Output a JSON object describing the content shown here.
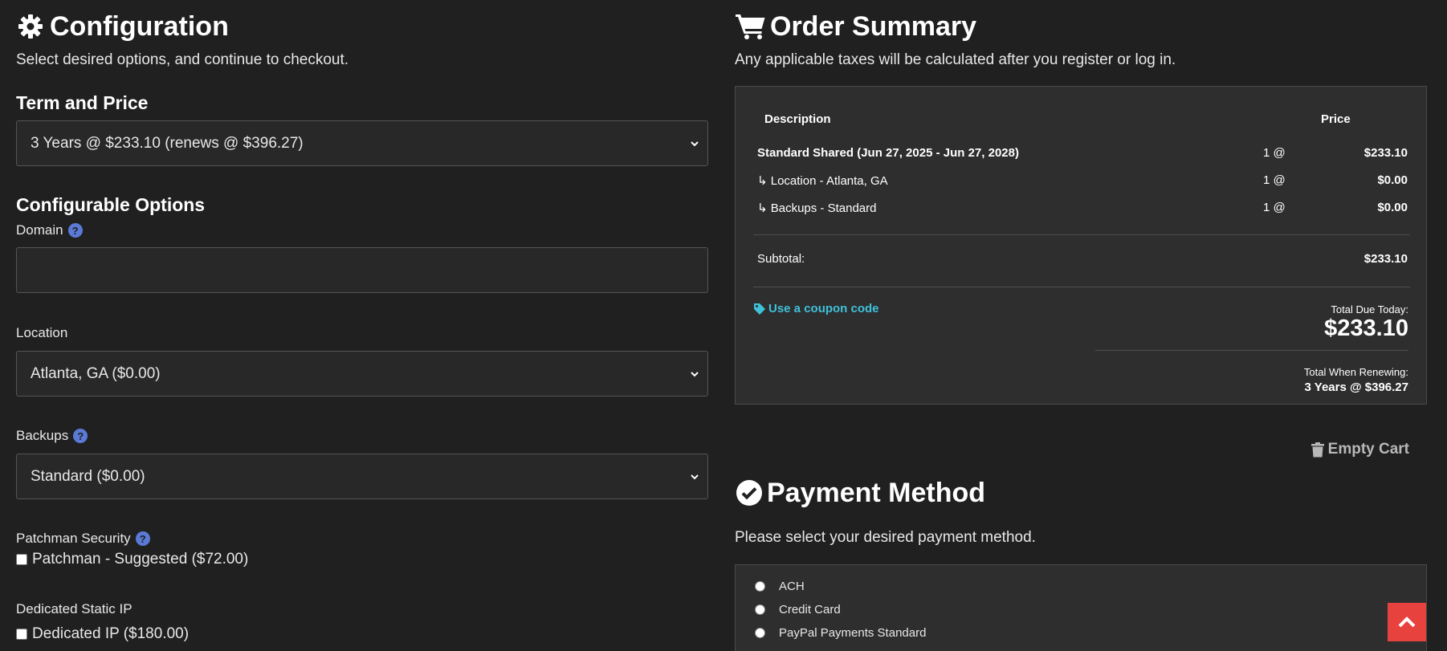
{
  "configuration": {
    "title": "Configuration",
    "icon": "gear-icon",
    "subtitle": "Select desired options, and continue to checkout.",
    "term_heading": "Term and Price",
    "term_selected": "3 Years @ $233.10 (renews @ $396.27)",
    "options_heading": "Configurable Options",
    "domain_label": "Domain",
    "domain_value": "",
    "location_label": "Location",
    "location_selected": "Atlanta, GA ($0.00)",
    "backups_label": "Backups",
    "backups_selected": "Standard ($0.00)",
    "patchman_label": "Patchman Security",
    "patchman_option": "Patchman - Suggested ($72.00)",
    "static_ip_label": "Dedicated Static IP",
    "static_ip_option": "Dedicated IP ($180.00)"
  },
  "summary": {
    "title": "Order Summary",
    "icon": "cart-icon",
    "subtitle": "Any applicable taxes will be calculated after you register or log in.",
    "col_description": "Description",
    "col_price": "Price",
    "items": [
      {
        "description": "Standard Shared (Jun 27, 2025 - Jun 27, 2028)",
        "qty": "1 @",
        "price": "$233.10"
      },
      {
        "description": "↳ Location - Atlanta, GA",
        "qty": "1 @",
        "price": "$0.00"
      },
      {
        "description": "↳ Backups - Standard",
        "qty": "1 @",
        "price": "$0.00"
      }
    ],
    "subtotal_label": "Subtotal:",
    "subtotal_value": "$233.10",
    "coupon_label": "Use a coupon code",
    "total_due_label": "Total Due Today:",
    "total_due_value": "$233.10",
    "renew_label": "Total When Renewing:",
    "renew_value": "3 Years @ $396.27",
    "empty_cart": "Empty Cart"
  },
  "payment": {
    "title": "Payment Method",
    "icon": "check-circle-icon",
    "subtitle": "Please select your desired payment method.",
    "methods": [
      "ACH",
      "Credit Card",
      "PayPal Payments Standard"
    ]
  },
  "colors": {
    "background": "#202020",
    "accent": "#3fc1d9",
    "help": "#5b7ad6",
    "scroll_top": "#e8423f"
  }
}
